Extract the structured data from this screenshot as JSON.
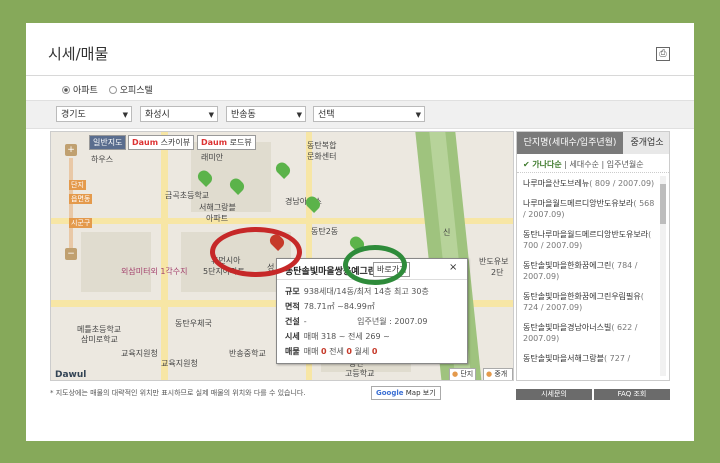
{
  "page": {
    "title": "시세/매물",
    "print_icon": "printer-icon"
  },
  "radios": [
    {
      "label": "아파트",
      "checked": true
    },
    {
      "label": "오피스텔",
      "checked": false
    }
  ],
  "filters": [
    "경기도",
    "화성시",
    "반송동",
    "선택"
  ],
  "map": {
    "buttons": {
      "normal": "일반지도",
      "sky": "스카이뷰",
      "road": "로드뷰",
      "daum": "Daum"
    },
    "zoom_tags": [
      "단지",
      "읍면동",
      "시군구"
    ],
    "labels": {
      "l1": "하우스",
      "l2": "래미안",
      "l3": "금곡초등학교",
      "l4": "서해그랑블",
      "l5": "아파트",
      "l6": "휴먼시아",
      "l7": "5단지아파트",
      "l8": "외삼미터외 1각수지",
      "l9": "동탄복합",
      "l10": "문화센터",
      "l11": "경남아너스",
      "l12": "동탄우체국",
      "l13": "메틀초등학교",
      "l14": "삼미로학교",
      "l15": "교육지원청",
      "l16": "교육지원청",
      "l17": "반송중학교",
      "l18": "동탄",
      "l19": "고등학교",
      "l20": "반도유보",
      "l21": "2단",
      "l22": "신",
      "l23": "동탄2동",
      "l24": "성",
      "l25": "동탄"
    },
    "legend": {
      "complex": "단지",
      "agent": "중개업소"
    },
    "copyright": "Dawul"
  },
  "popup": {
    "title": "동탄솔빛마을쌍용예그린",
    "goto_label": "바로가기",
    "close": "×",
    "rows": {
      "scale_label": "규모",
      "scale_value": "938세대/14동/최저 14층 최고 30층",
      "area_label": "면적",
      "area_value": "78.71㎡ ~84.99㎡",
      "built_label": "건설",
      "built_value": "-",
      "move_label": "입주년월",
      "move_value": "2007.09",
      "price_label": "시세",
      "price_value": "매매 318 ~ 전세 269 ~",
      "listing_label": "매물",
      "listing_sale": "매매",
      "sale_count": "0",
      "listing_jeonse": "전세",
      "jeonse_count": "0",
      "listing_monthly": "월세",
      "monthly_count": "0"
    }
  },
  "sidebar": {
    "tabs": [
      "단지명(세대수/입주년월)",
      "중개업소"
    ],
    "sort": {
      "active": "가나다순",
      "s2": "세대수순",
      "s3": "입주년월순",
      "sep": "|"
    },
    "items": [
      {
        "name": "나루마을산도브레뉴",
        "meta": "( 809 / 2007.09)"
      },
      {
        "name": "나루마을월드메르디앙반도유보라",
        "meta": "( 568 / 2007.09)"
      },
      {
        "name": "동탄나루마을월드메르디앙반도유보라",
        "meta": "( 700 / 2007.09)"
      },
      {
        "name": "동탄솔빛마을한화꿈에그린",
        "meta": "( 784 / 2007.09)"
      },
      {
        "name": "동탄솔빛마을한화꿈에그린우림필유",
        "meta": "( 724 / 2007.09)"
      },
      {
        "name": "동탄솔빛마을경남아너스빌",
        "meta": "( 622 / 2007.09)"
      },
      {
        "name": "동탄솔빛마을서해그랑블",
        "meta": "( 727 /"
      }
    ]
  },
  "footer": {
    "note": "* 지도상에는 매물의 대략적인 위치만 표시하므로 실제 매물의 위치와 다를 수 있습니다.",
    "google_g": "Google",
    "google_rest": "Map 보기",
    "inquiry": "시세문의",
    "faq": "FAQ 조회"
  },
  "colors": {
    "background": "#86a95a",
    "pin_green": "#5bb34a",
    "pin_red": "#c63a2a",
    "ring_red": "#c62828",
    "ring_green": "#2e8b3a"
  }
}
